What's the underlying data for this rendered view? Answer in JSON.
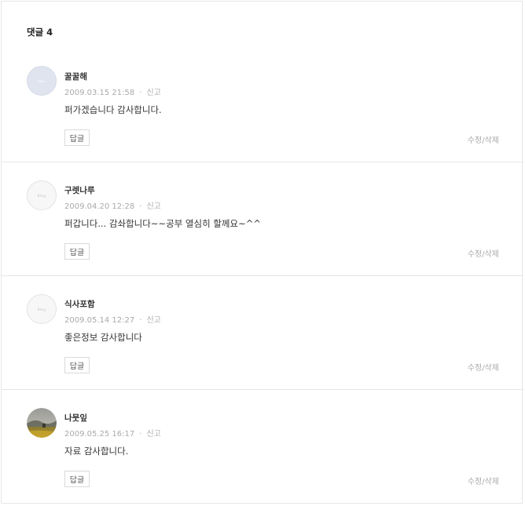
{
  "comments_section": {
    "heading": "댓글 4",
    "reply_label": "답글",
    "edit_delete_label": "수정/삭제",
    "report_label": "신고",
    "items": [
      {
        "author": "꿀꿀해",
        "date": "2009.03.15 21:58",
        "text": "퍼가겠습니다 감사합니다.",
        "avatar": "default-blue-profile",
        "avatar_mark": "kkul"
      },
      {
        "author": "구렛나루",
        "date": "2009.04.20 12:28",
        "text": "퍼갑니다... 감솨합니다~~공부 열심히 할께요~^^",
        "avatar": "blog-default-profile",
        "avatar_mark": "Blog"
      },
      {
        "author": "식사포함",
        "date": "2009.05.14 12:27",
        "text": "좋은정보 감사합니다",
        "avatar": "blog-default-profile",
        "avatar_mark": "Blog"
      },
      {
        "author": "나뭇잎",
        "date": "2009.05.25 16:17",
        "text": "자료 감사합니다.",
        "avatar": "landscape-photo-profile",
        "avatar_mark": ""
      }
    ]
  },
  "colors": {
    "border": "#e6e6e6",
    "meta_text": "#aaaaaa",
    "body_text": "#333333"
  }
}
